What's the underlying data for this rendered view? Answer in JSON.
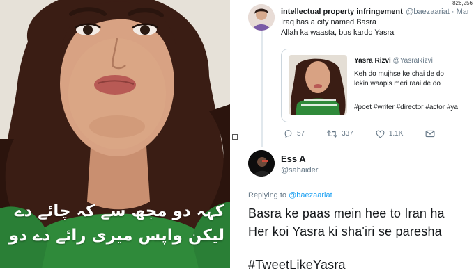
{
  "photo": {
    "urdu_line1": "کہہ دو مجھ سے کہ چائے دے",
    "urdu_line2": "لیکن واپس میری رائے دے دو"
  },
  "coords_readout": "826,256",
  "tweet1": {
    "name": "intellectual property infringement",
    "handle": "@baezaariat · Mar",
    "line1": "Iraq has a city named Basra",
    "line2": "Allah ka waasta, bus kardo Yasra"
  },
  "quoted": {
    "name": "Yasra Rizvi",
    "handle": "@YasraRizvi",
    "line1": "Keh do mujhse ke chai de do",
    "line2": "lekin waapis meri raai de do",
    "tags": "#poet #writer #director #actor #ya"
  },
  "actions": {
    "replies": "57",
    "retweets": "337",
    "likes": "1.1K"
  },
  "tweet2": {
    "name": "Ess A",
    "handle": "@sahaider",
    "replying_prefix": "Replying to",
    "replying_to": "@baezaariat",
    "line1": "Basra ke paas mein hee to Iran ha",
    "line2": "Her koi Yasra ki sha'iri se paresha",
    "line3": "#TweetLikeYasra"
  }
}
